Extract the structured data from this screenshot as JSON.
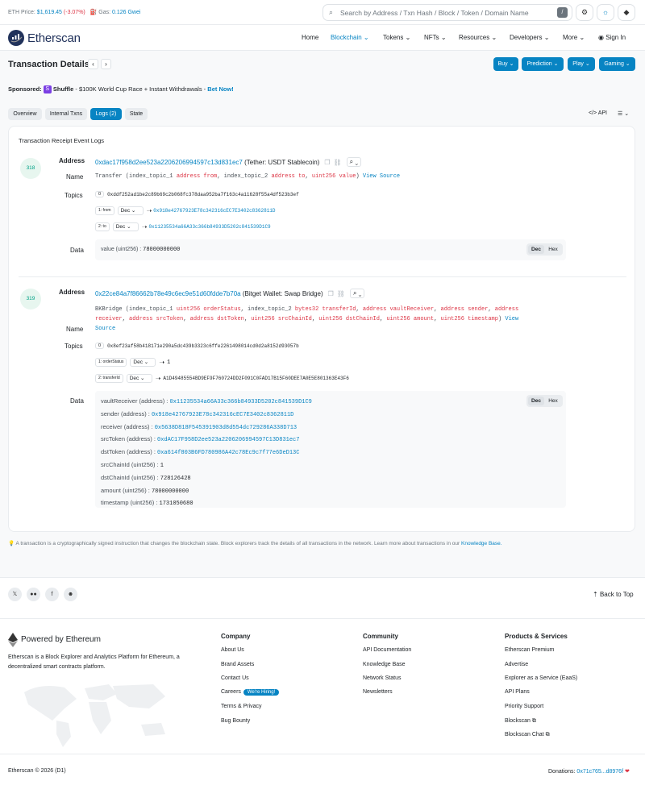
{
  "topbar": {
    "eth_label": "ETH Price:",
    "eth_price": "$1,619.45",
    "eth_change": "(-3.07%)",
    "gas_label": "Gas:",
    "gas_value": "0.126 Gwei",
    "search_placeholder": "Search by Address / Txn Hash / Block / Token / Domain Name",
    "search_shortcut": "/"
  },
  "nav": {
    "brand": "Etherscan",
    "items": [
      "Home",
      "Blockchain",
      "Tokens",
      "NFTs",
      "Resources",
      "Developers",
      "More"
    ],
    "signin": "Sign In"
  },
  "header": {
    "title": "Transaction Details",
    "prev": "‹",
    "next": "›",
    "buttons": [
      "Buy",
      "Prediction",
      "Play",
      "Gaming"
    ]
  },
  "sponsored": {
    "label": "Sponsored:",
    "brand": "Shuffle",
    "text": "- $100K World Cup Race + Instant Withdrawals -",
    "cta": "Bet Now!"
  },
  "tabs": [
    "Overview",
    "Internal Txns",
    "Logs (2)",
    "State"
  ],
  "tools": {
    "api": "API"
  },
  "card_title": "Transaction Receipt Event Logs",
  "logs": [
    {
      "index": "318",
      "address_label": "Address",
      "address": "0xdac17f958d2ee523a2206206994597c13d831ec7",
      "address_tag": "(Tether: USDT Stablecoin)",
      "name_label": "Name",
      "name_prefix": "Transfer (index_topic_1 ",
      "name_parts": [
        [
          "address from",
          "kw"
        ],
        [
          ", index_topic_2 ",
          ""
        ],
        [
          "address to",
          "kw"
        ],
        [
          ", ",
          ""
        ],
        [
          "uint256 value",
          "kw"
        ],
        [
          ")",
          ""
        ]
      ],
      "view_source": "View Source",
      "topics_label": "Topics",
      "topic0": "0xddf252ad1be2c89b69c2b068fc378daa952ba7f163c4a11628f55a4df523b3ef",
      "topic1_tag": "1: from",
      "topic1_fmt": "Dec",
      "topic1_val": "0x918e42767923E78c342316cEC7E3402c8362811D",
      "topic2_tag": "2: to",
      "topic2_fmt": "Dec",
      "topic2_val": "0x11235534a66A33c366b84933D5202c841539D1C9",
      "data_label": "Data",
      "data_line": "value (uint256) :",
      "data_value": "78000000000",
      "toggle": [
        "Dec",
        "Hex"
      ]
    },
    {
      "index": "319",
      "address_label": "Address",
      "address": "0x22ce84a7f86662b78e49c6ec9e51d60fdde7b70a",
      "address_tag": "(Bitget Wallet: Swap Bridge)",
      "name_label": "Name",
      "name_line1_prefix": "BKBridge (index_topic_1 ",
      "name_line1_rest": "uint256 orderStatus",
      "name_line1_mid": ", index_topic_2 ",
      "name_line1_b": "bytes32 transferId",
      "name_line1_c": ", ",
      "name_line1_d": "address vaultReceiver",
      "name_line1_e": ", ",
      "name_line1_f": "address sender",
      "name_line1_g": ", ",
      "name_line1_h": "address",
      "name_line2_a": "receiver",
      "name_line2_b": ", ",
      "name_line2_c": "address srcToken",
      "name_line2_d": ", ",
      "name_line2_e": "address dstToken",
      "name_line2_f": ", ",
      "name_line2_g": "uint256 srcChainId",
      "name_line2_h": ", ",
      "name_line2_i": "uint256 dstChainId",
      "name_line2_j": ", ",
      "name_line2_k": "uint256 amount",
      "name_line2_l": ", ",
      "name_line2_m": "uint256 timestamp",
      "name_line2_n": ") ",
      "view_source_a": "View",
      "view_source_b": "Source",
      "topics_label": "Topics",
      "topic0": "0x8ef23af58b418171e290a5dc439b3323c6ffe2261498014cd0d2a8152d93057b",
      "topic1_tag": "1: orderStatus",
      "topic1_fmt": "Dec",
      "topic1_val": "1",
      "topic2_tag": "2: transferId",
      "topic2_fmt": "Dec",
      "topic2_val": "A1D49485554BD9EF9F760724DD2F091C0FAD17B15F60DEE7A0E5E801363E43F6",
      "data_label": "Data",
      "data_rows": [
        {
          "k": "vaultReceiver (address) :",
          "v": "0x11235534a66A33c366b84933D5202c841539D1C9",
          "link": true
        },
        {
          "k": "sender (address) :",
          "v": "0x918e42767923E78c342316cEC7E3402c8362811D",
          "link": true
        },
        {
          "k": "receiver (address) :",
          "v": "0x5638D818F545391903d8d554dc729286A338D713",
          "link": true
        },
        {
          "k": "srcToken (address) :",
          "v": "0xdAC17F958D2ee523a2206206994597C13D831ec7",
          "link": true
        },
        {
          "k": "dstToken (address) :",
          "v": "0xa614f803B6FD780986A42c78Ec9c7f77e6DeD13C",
          "link": true
        },
        {
          "k": "srcChainId (uint256) :",
          "v": "1",
          "link": false
        },
        {
          "k": "dstChainId (uint256) :",
          "v": "728126428",
          "link": false
        },
        {
          "k": "amount (uint256) :",
          "v": "78000000000",
          "link": false
        },
        {
          "k": "timestamp (uint256) :",
          "v": "1731050680",
          "link": false
        }
      ],
      "toggle": [
        "Dec",
        "Hex"
      ]
    }
  ],
  "footnote": {
    "text": "A transaction is a cryptographically signed instruction that changes the blockchain state. Block explorers track the details of all transactions in the network. Learn more about transactions in our",
    "link": "Knowledge Base."
  },
  "footer": {
    "back_to_top": "Back to Top",
    "powered": "Powered by Ethereum",
    "about": "Etherscan is a Block Explorer and Analytics Platform for Ethereum, a decentralized smart contracts platform.",
    "columns": [
      {
        "title": "Company",
        "links": [
          "About Us",
          "Brand Assets",
          "Contact Us",
          "Careers",
          "Terms & Privacy",
          "Bug Bounty"
        ]
      },
      {
        "title": "Community",
        "links": [
          "API Documentation",
          "Knowledge Base",
          "Network Status",
          "Newsletters"
        ]
      },
      {
        "title": "Products & Services",
        "links": [
          "Etherscan Premium",
          "Advertise",
          "Explorer as a Service (EaaS)",
          "API Plans",
          "Priority Support",
          "Blockscan",
          "Blockscan Chat"
        ]
      }
    ],
    "hiring": "We're Hiring!",
    "copyright": "Etherscan © 2026 (D1)",
    "donations_label": "Donations:",
    "donations_addr": "0x71c765...d8976f",
    "heart": "❤"
  },
  "colors": {
    "accent": "#0784c3",
    "danger": "#dc3545",
    "success": "#00a186"
  }
}
